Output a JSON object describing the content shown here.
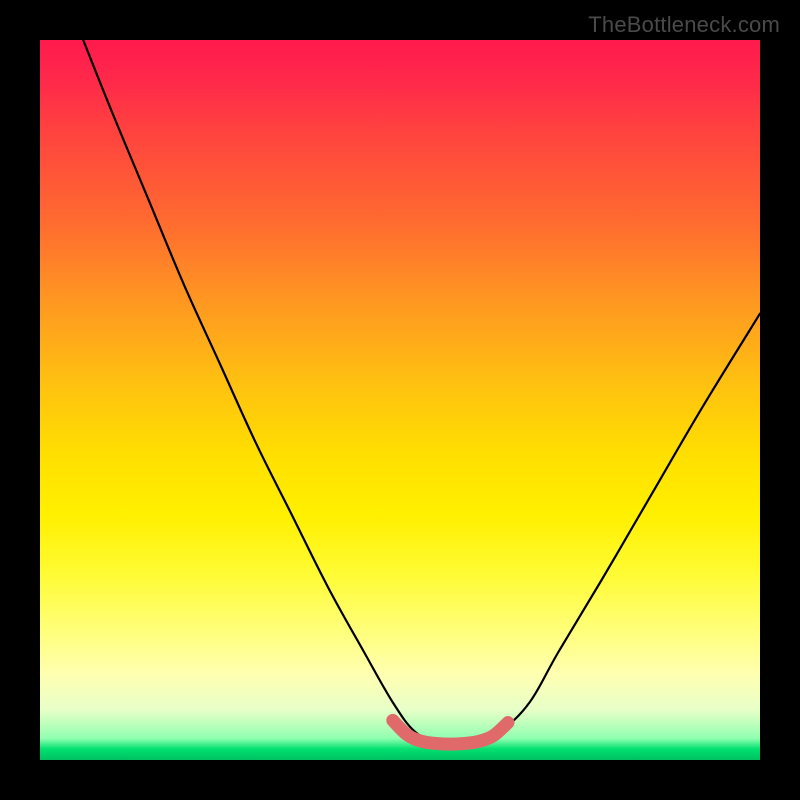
{
  "watermark": "TheBottleneck.com",
  "chart_data": {
    "type": "line",
    "title": "",
    "xlabel": "",
    "ylabel": "",
    "xlim": [
      0,
      100
    ],
    "ylim": [
      0,
      100
    ],
    "grid": false,
    "series": [
      {
        "name": "curve",
        "color": "#000000",
        "x": [
          6,
          10,
          15,
          20,
          25,
          30,
          35,
          40,
          45,
          49,
          52,
          55,
          58,
          61,
          64,
          68,
          72,
          78,
          85,
          92,
          100
        ],
        "y": [
          100,
          90,
          78,
          66,
          55,
          44,
          34,
          24,
          15,
          8,
          4,
          2.5,
          2.2,
          2.5,
          4,
          8,
          15,
          25,
          37,
          49,
          62
        ]
      },
      {
        "name": "highlight",
        "color": "#e06a6a",
        "x": [
          49,
          51,
          53,
          55,
          57,
          59,
          61,
          63,
          65
        ],
        "y": [
          5.5,
          3.5,
          2.6,
          2.3,
          2.2,
          2.3,
          2.6,
          3.4,
          5.2
        ]
      }
    ],
    "annotations": []
  }
}
